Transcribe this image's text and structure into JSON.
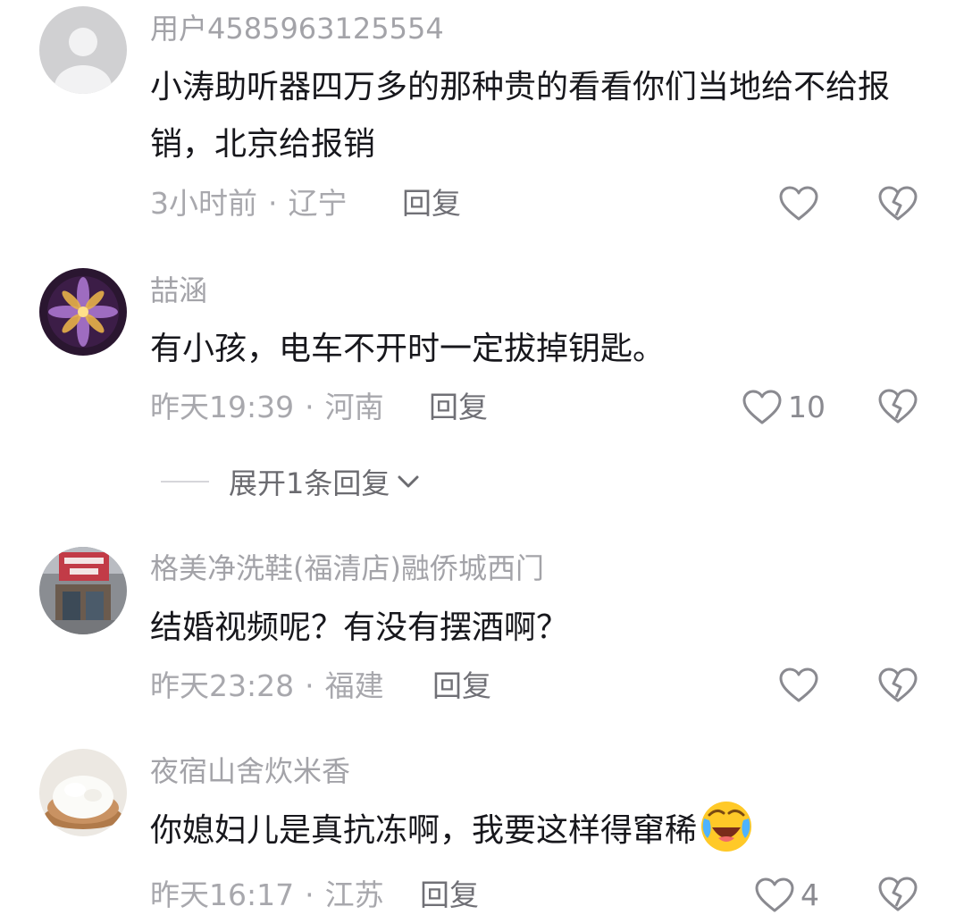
{
  "comments": [
    {
      "username": "用户4585963125554",
      "text": "小涛助听器四万多的那种贵的看看你们当地给不给报销，北京给报销",
      "time": "3小时前",
      "region": "辽宁",
      "reply_label": "回复",
      "like_count": ""
    },
    {
      "username": "喆涵",
      "text": "有小孩，电车不开时一定拔掉钥匙。",
      "time": "昨天19:39",
      "region": "河南",
      "reply_label": "回复",
      "like_count": "10",
      "expand_label": "展开1条回复"
    },
    {
      "username": "格美净洗鞋(福清店)融侨城西门",
      "text": "结婚视频呢？有没有摆酒啊？",
      "time": "昨天23:28",
      "region": "福建",
      "reply_label": "回复",
      "like_count": ""
    },
    {
      "username": "夜宿山舍炊米香",
      "text": "你媳妇儿是真抗冻啊，我要这样得窜稀",
      "time": "昨天16:17",
      "region": "江苏",
      "reply_label": "回复",
      "like_count": "4"
    }
  ],
  "separator": "·",
  "icons": {
    "like": "heart-outline-icon",
    "dislike": "broken-heart-icon",
    "expand": "chevron-down-icon",
    "emoji": "laughing-crying-emoji-icon"
  },
  "colors": {
    "username": "#a3a3a8",
    "text": "#17171c",
    "meta": "#a8a8ad",
    "icon": "#8a8a90"
  }
}
